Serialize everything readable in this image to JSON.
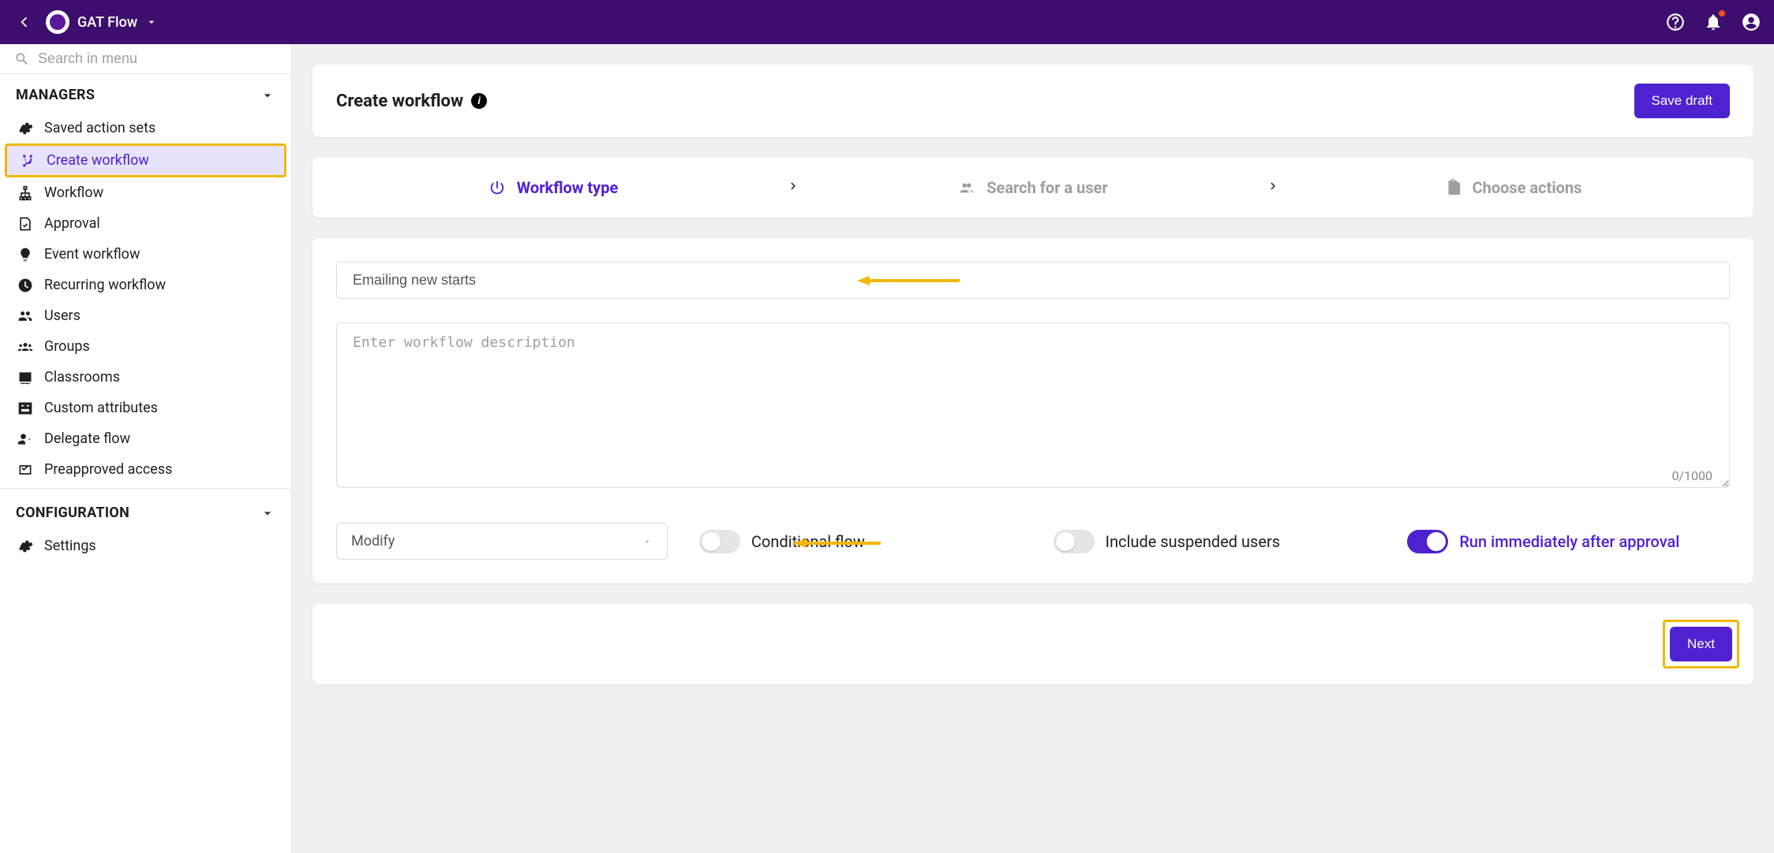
{
  "topbar": {
    "brand_label": "GAT Flow"
  },
  "sidebar": {
    "search_placeholder": "Search in menu",
    "sections": {
      "managers": {
        "label": "MANAGERS"
      },
      "configuration": {
        "label": "CONFIGURATION"
      }
    },
    "items": {
      "saved_action_sets": "Saved action sets",
      "create_workflow": "Create workflow",
      "workflow": "Workflow",
      "approval": "Approval",
      "event_workflow": "Event workflow",
      "recurring_workflow": "Recurring workflow",
      "users": "Users",
      "groups": "Groups",
      "classrooms": "Classrooms",
      "custom_attributes": "Custom attributes",
      "delegate_flow": "Delegate flow",
      "preapproved_access": "Preapproved access",
      "settings": "Settings"
    }
  },
  "page": {
    "title": "Create workflow",
    "save_draft": "Save draft"
  },
  "stepper": {
    "step1": "Workflow type",
    "step2": "Search for a user",
    "step3": "Choose actions"
  },
  "form": {
    "name_value": "Emailing new starts",
    "desc_placeholder": "Enter workflow description",
    "char_count": "0/1000",
    "modify_selected": "Modify",
    "conditional_flow_label": "Conditional flow",
    "include_suspended_label": "Include suspended users",
    "run_immediately_label": "Run immediately after approval"
  },
  "footer": {
    "next": "Next"
  }
}
